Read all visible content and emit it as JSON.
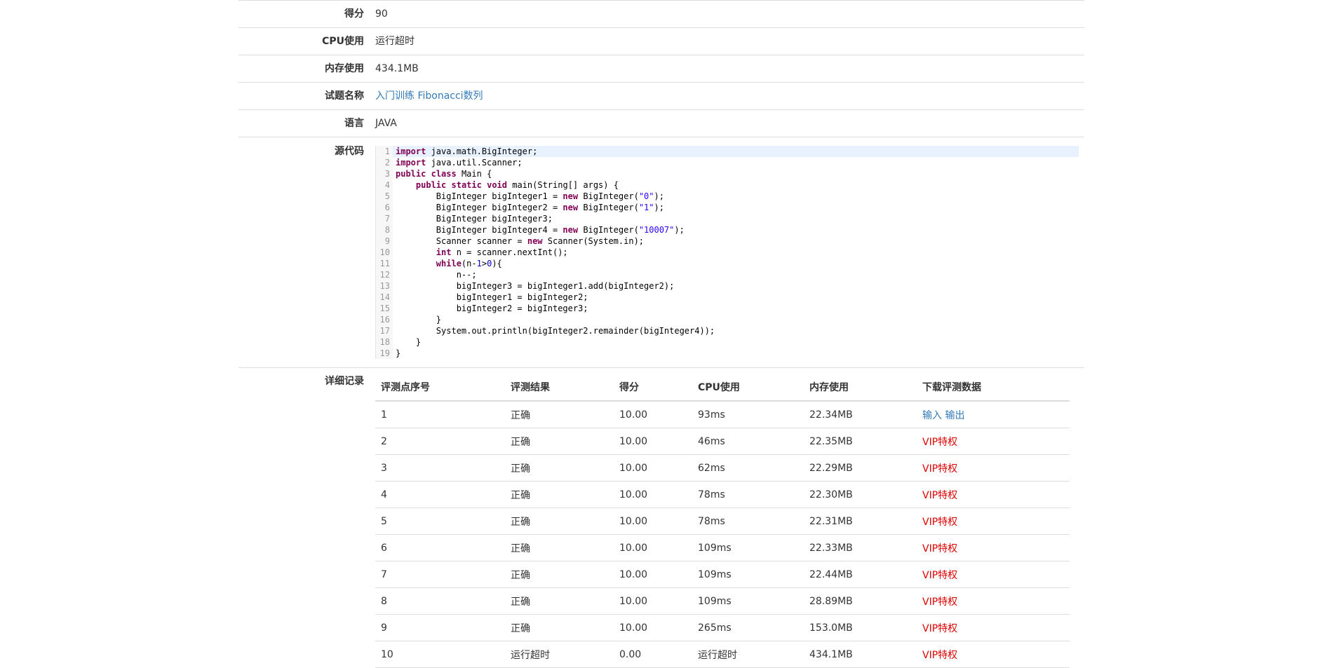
{
  "info": {
    "score_label": "得分",
    "score_value": "90",
    "cpu_label": "CPU使用",
    "cpu_value": "运行超时",
    "mem_label": "内存使用",
    "mem_value": "434.1MB",
    "problem_label": "试题名称",
    "problem_value": "入门训练 Fibonacci数列",
    "lang_label": "语言",
    "lang_value": "JAVA",
    "source_label": "源代码",
    "details_label": "详细记录"
  },
  "code_lines": [
    "import java.math.BigInteger;",
    "import java.util.Scanner;",
    "public class Main {",
    "    public static void main(String[] args) {",
    "        BigInteger bigInteger1 = new BigInteger(\"0\");",
    "        BigInteger bigInteger2 = new BigInteger(\"1\");",
    "        BigInteger bigInteger3;",
    "        BigInteger bigInteger4 = new BigInteger(\"10007\");",
    "        Scanner scanner = new Scanner(System.in);",
    "        int n = scanner.nextInt();",
    "        while(n-1>0){",
    "            n--;",
    "            bigInteger3 = bigInteger1.add(bigInteger2);",
    "            bigInteger1 = bigInteger2;",
    "            bigInteger2 = bigInteger3;",
    "        }",
    "        System.out.println(bigInteger2.remainder(bigInteger4));",
    "    }",
    "}"
  ],
  "table": {
    "headers": [
      "评测点序号",
      "评测结果",
      "得分",
      "CPU使用",
      "内存使用",
      "下载评测数据"
    ],
    "rows": [
      {
        "id": "1",
        "result": "正确",
        "score": "10.00",
        "cpu": "93ms",
        "mem": "22.34MB",
        "input": "输入",
        "output": "输出"
      },
      {
        "id": "2",
        "result": "正确",
        "score": "10.00",
        "cpu": "46ms",
        "mem": "22.35MB",
        "vip": "VIP特权"
      },
      {
        "id": "3",
        "result": "正确",
        "score": "10.00",
        "cpu": "62ms",
        "mem": "22.29MB",
        "vip": "VIP特权"
      },
      {
        "id": "4",
        "result": "正确",
        "score": "10.00",
        "cpu": "78ms",
        "mem": "22.30MB",
        "vip": "VIP特权"
      },
      {
        "id": "5",
        "result": "正确",
        "score": "10.00",
        "cpu": "78ms",
        "mem": "22.31MB",
        "vip": "VIP特权"
      },
      {
        "id": "6",
        "result": "正确",
        "score": "10.00",
        "cpu": "109ms",
        "mem": "22.33MB",
        "vip": "VIP特权"
      },
      {
        "id": "7",
        "result": "正确",
        "score": "10.00",
        "cpu": "109ms",
        "mem": "22.44MB",
        "vip": "VIP特权"
      },
      {
        "id": "8",
        "result": "正确",
        "score": "10.00",
        "cpu": "109ms",
        "mem": "28.89MB",
        "vip": "VIP特权"
      },
      {
        "id": "9",
        "result": "正确",
        "score": "10.00",
        "cpu": "265ms",
        "mem": "153.0MB",
        "vip": "VIP特权"
      },
      {
        "id": "10",
        "result": "运行超时",
        "score": "0.00",
        "cpu": "运行超时",
        "mem": "434.1MB",
        "vip": "VIP特权"
      }
    ]
  },
  "colors": {
    "link": "#337ab7",
    "vip": "#e00000",
    "border": "#dddddd",
    "highlight": "#e8f2fe"
  }
}
